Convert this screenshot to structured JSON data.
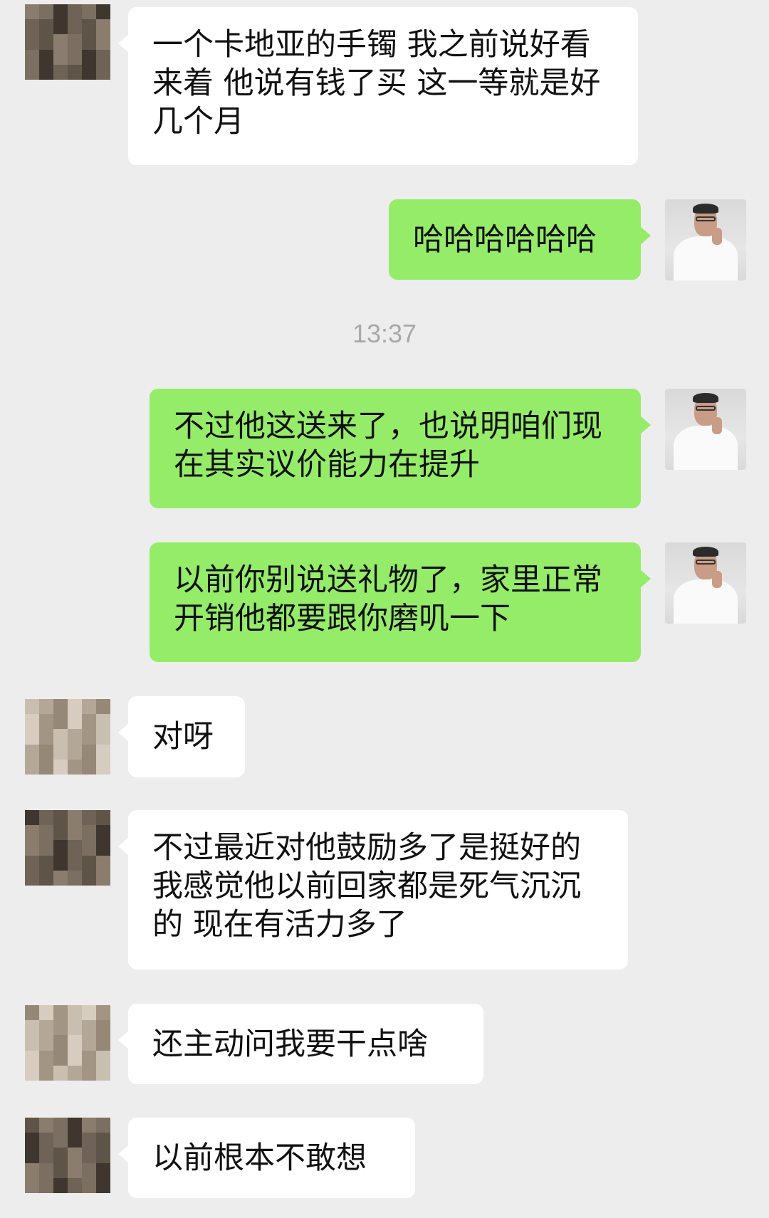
{
  "timestamp": "13:37",
  "messages": [
    {
      "text": "一个卡地亚的手镯 我之前说好看来着 他说有钱了买 这一等就是好几个月"
    },
    {
      "text": "哈哈哈哈哈哈"
    },
    {
      "text": "不过他这送来了，也说明咱们现在其实议价能力在提升"
    },
    {
      "text": "以前你别说送礼物了，家里正常开销他都要跟你磨叽一下"
    },
    {
      "text": "对呀"
    },
    {
      "text": "不过最近对他鼓励多了是挺好的 我感觉他以前回家都是死气沉沉的 现在有活力多了"
    },
    {
      "text": "还主动问我要干点啥"
    },
    {
      "text": "以前根本不敢想"
    }
  ],
  "colors": {
    "background": "#ededed",
    "incoming_bubble": "#ffffff",
    "outgoing_bubble": "#95ec69",
    "timestamp": "#a8a8a8"
  }
}
